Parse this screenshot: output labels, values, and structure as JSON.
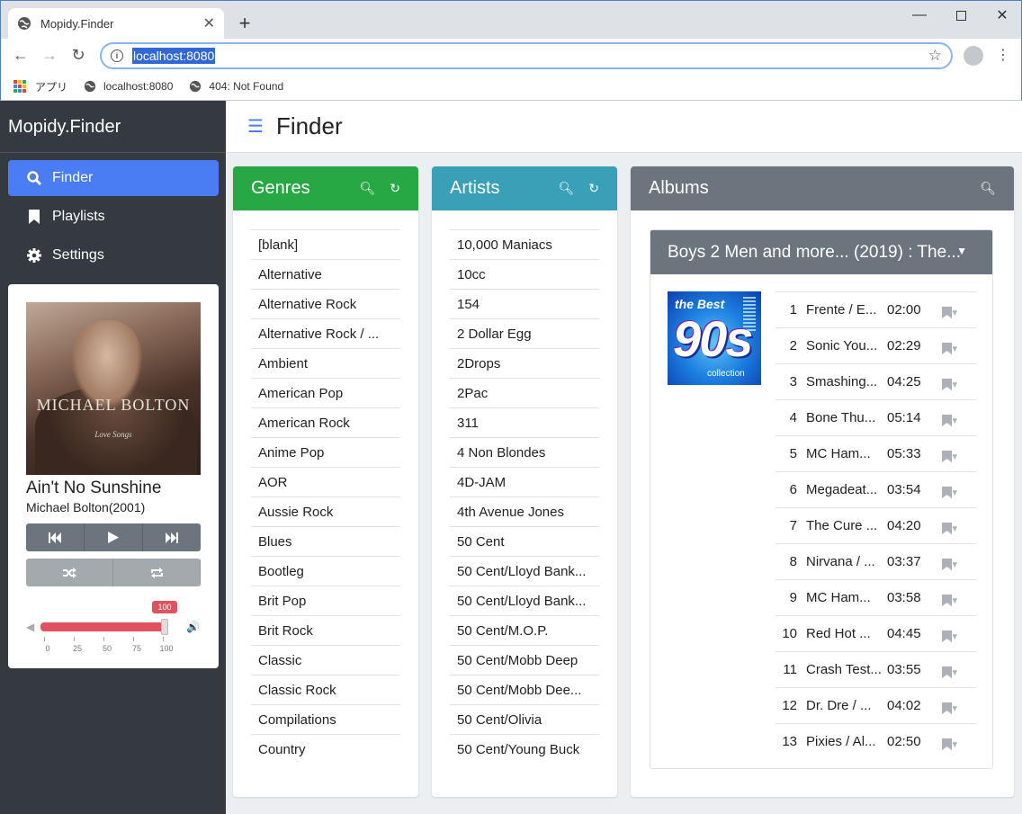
{
  "browser": {
    "tab_title": "Mopidy.Finder",
    "close_tab": "✕",
    "new_tab": "+",
    "url": "localhost:8080",
    "bookmarks": [
      {
        "label": "アプリ"
      },
      {
        "label": "localhost:8080"
      },
      {
        "label": "404: Not Found"
      }
    ]
  },
  "sidebar": {
    "brand": "Mopidy.Finder",
    "items": [
      {
        "label": "Finder",
        "icon": "search-icon",
        "active": true
      },
      {
        "label": "Playlists",
        "icon": "bookmark-icon",
        "active": false
      },
      {
        "label": "Settings",
        "icon": "gear-icon",
        "active": false
      }
    ]
  },
  "player": {
    "cover_artist": "MICHAEL BOLTON",
    "cover_subtitle": "Love Songs",
    "title": "Ain't No Sunshine",
    "artist": "Michael Bolton(2001)",
    "volume": 100,
    "volume_label": "100",
    "volume_ticks": [
      "0",
      "25",
      "50",
      "75",
      "100"
    ]
  },
  "page": {
    "title": "Finder"
  },
  "genres": {
    "title": "Genres",
    "color": "#28a745",
    "items": [
      "[blank]",
      "Alternative",
      "Alternative Rock",
      "Alternative Rock / ...",
      "Ambient",
      "American Pop",
      "American Rock",
      "Anime Pop",
      "AOR",
      "Aussie Rock",
      "Blues",
      "Bootleg",
      "Brit Pop",
      "Brit Rock",
      "Classic",
      "Classic Rock",
      "Compilations",
      "Country"
    ]
  },
  "artists": {
    "title": "Artists",
    "color": "#3aa0b8",
    "items": [
      "10,000 Maniacs",
      "10cc",
      "154",
      "2 Dollar Egg",
      "2Drops",
      "2Pac",
      "311",
      "4 Non Blondes",
      "4D-JAM",
      "4th Avenue Jones",
      "50 Cent",
      "50 Cent/Lloyd Bank...",
      "50 Cent/Lloyd Bank...",
      "50 Cent/M.O.P.",
      "50 Cent/Mobb Deep",
      "50 Cent/Mobb Dee...",
      "50 Cent/Olivia",
      "50 Cent/Young Buck"
    ]
  },
  "albums": {
    "title": "Albums",
    "color": "#6c757d",
    "album_title": "Boys 2 Men and more... (2019) : The...",
    "thumb_top": "the Best",
    "thumb_big": "90s",
    "thumb_bottom": "collection",
    "tracks": [
      {
        "no": "1",
        "title": "Frente / E...",
        "duration": "02:00"
      },
      {
        "no": "2",
        "title": "Sonic You...",
        "duration": "02:29"
      },
      {
        "no": "3",
        "title": "Smashing...",
        "duration": "04:25"
      },
      {
        "no": "4",
        "title": "Bone Thu...",
        "duration": "05:14"
      },
      {
        "no": "5",
        "title": "MC Ham...",
        "duration": "05:33"
      },
      {
        "no": "6",
        "title": "Megadeat...",
        "duration": "03:54"
      },
      {
        "no": "7",
        "title": "The Cure ...",
        "duration": "04:20"
      },
      {
        "no": "8",
        "title": "Nirvana / ...",
        "duration": "03:37"
      },
      {
        "no": "9",
        "title": "MC Ham...",
        "duration": "03:58"
      },
      {
        "no": "10",
        "title": "Red Hot ...",
        "duration": "04:45"
      },
      {
        "no": "11",
        "title": "Crash Test...",
        "duration": "03:55"
      },
      {
        "no": "12",
        "title": "Dr. Dre / ...",
        "duration": "04:02"
      },
      {
        "no": "13",
        "title": "Pixies / Al...",
        "duration": "02:50"
      }
    ]
  }
}
